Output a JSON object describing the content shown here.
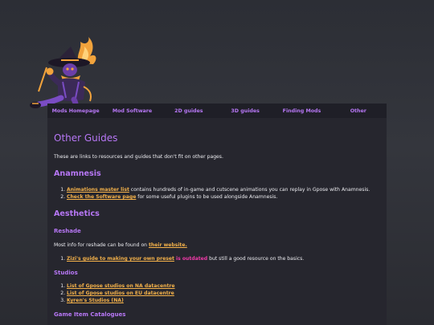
{
  "nav": [
    "Mods Homepage",
    "Mod Software",
    "2D guides",
    "3D guides",
    "Finding Mods",
    "Other"
  ],
  "page": {
    "title": "Other Guides",
    "intro": "These are links to resources and guides that don't fit on other pages."
  },
  "anamnesis": {
    "heading": "Anamnesis",
    "items": [
      {
        "link": "Animations master list",
        "text": " contains hundreds of in-game and cutscene animations you can replay in Gpose with Anamnesis."
      },
      {
        "link": "Check the Software page",
        "text": " for some useful plugins to be used alongside Anamnesis."
      }
    ]
  },
  "aesthetics": {
    "heading": "Aesthetics",
    "reshade": {
      "heading": "Reshade",
      "text": "Most info for reshade can be found on ",
      "link": "their website.",
      "item": {
        "link": "Zizi's guide to making your own preset",
        "warn": " is outdated",
        "text": " but still a good resource on the basics."
      }
    },
    "studios": {
      "heading": "Studios",
      "items": [
        "List of Gpose studios on NA datacentre",
        "List of Gpose studios on EU datacentre",
        "Kyren's Studios (NA)"
      ]
    },
    "catalogues": {
      "heading": "Game Item Catalogues"
    }
  },
  "colors": {
    "accent": "#b777f5",
    "link": "#f5b24a",
    "warning": "#f03aa8",
    "panel": "#26262e",
    "nav": "#1f1f27"
  }
}
